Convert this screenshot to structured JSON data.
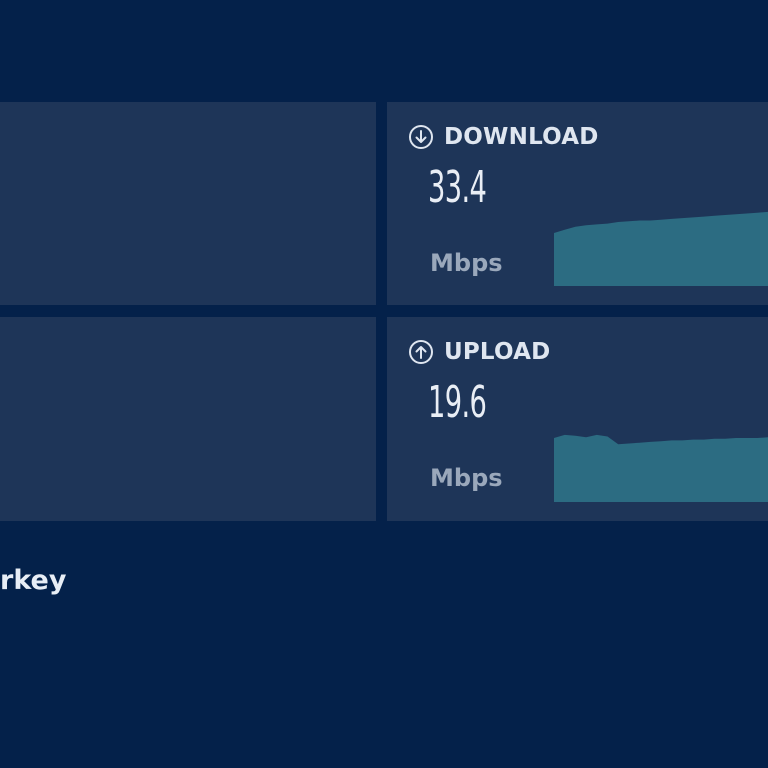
{
  "download": {
    "title": "DOWNLOAD",
    "value": "33.4",
    "unit": "Mbps",
    "icon": "download-arrow-icon",
    "graph_profile": [
      0.68,
      0.72,
      0.76,
      0.78,
      0.79,
      0.8,
      0.82,
      0.83,
      0.84,
      0.84,
      0.85,
      0.86,
      0.87,
      0.88,
      0.89,
      0.9,
      0.91,
      0.92,
      0.93,
      0.94,
      0.95
    ]
  },
  "upload": {
    "title": "UPLOAD",
    "value": "19.6",
    "unit": "Mbps",
    "icon": "upload-arrow-icon",
    "graph_profile": [
      0.82,
      0.86,
      0.85,
      0.83,
      0.86,
      0.84,
      0.74,
      0.75,
      0.76,
      0.77,
      0.78,
      0.79,
      0.79,
      0.8,
      0.8,
      0.81,
      0.81,
      0.82,
      0.82,
      0.82,
      0.83
    ]
  },
  "location": {
    "text": "rkey"
  },
  "colors": {
    "background": "#04214a",
    "panel": "#1e3558",
    "graph_fill": "#2c6c82",
    "title_text": "#dfe6f0",
    "unit_text": "#9aa8bb"
  }
}
